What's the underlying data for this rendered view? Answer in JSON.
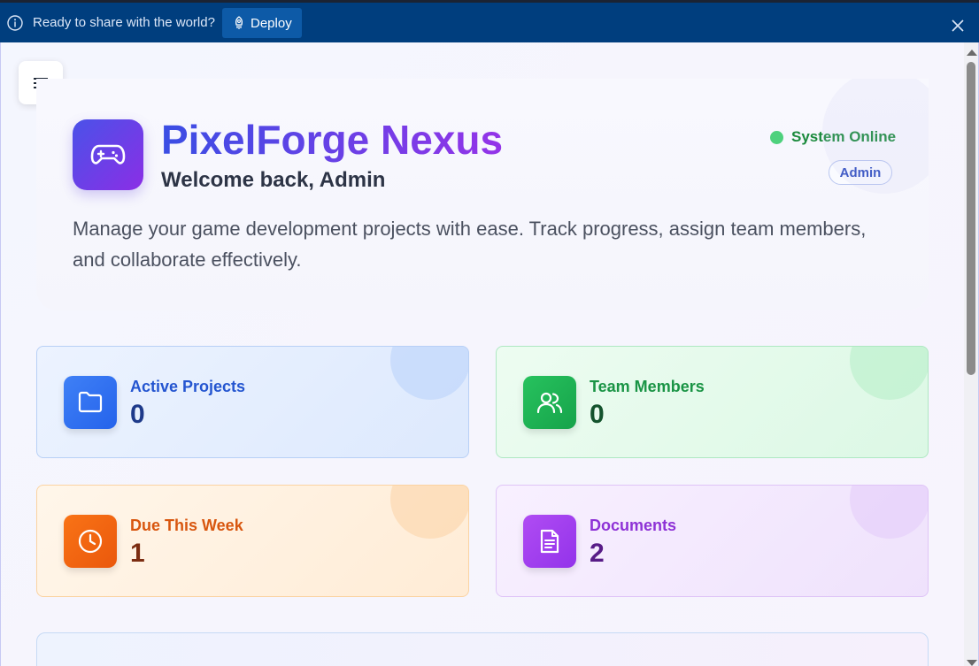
{
  "banner": {
    "message": "Ready to share with the world?",
    "deploy_label": "Deploy"
  },
  "hero": {
    "title": "PixelForge Nexus",
    "welcome": "Welcome back, Admin",
    "description": "Manage your game development projects with ease. Track progress, assign team members, and collaborate effectively.",
    "status": "System Online",
    "role": "Admin"
  },
  "stats": [
    {
      "label": "Active Projects",
      "value": "0",
      "icon": "folder-icon"
    },
    {
      "label": "Team Members",
      "value": "0",
      "icon": "users-icon"
    },
    {
      "label": "Due This Week",
      "value": "1",
      "icon": "clock-icon"
    },
    {
      "label": "Documents",
      "value": "2",
      "icon": "document-icon"
    }
  ],
  "colors": {
    "banner_bg": "#003e7e",
    "brand_gradient_start": "#4a52e8",
    "brand_gradient_end": "#8b2ee6",
    "status_online": "#4ed17d"
  }
}
